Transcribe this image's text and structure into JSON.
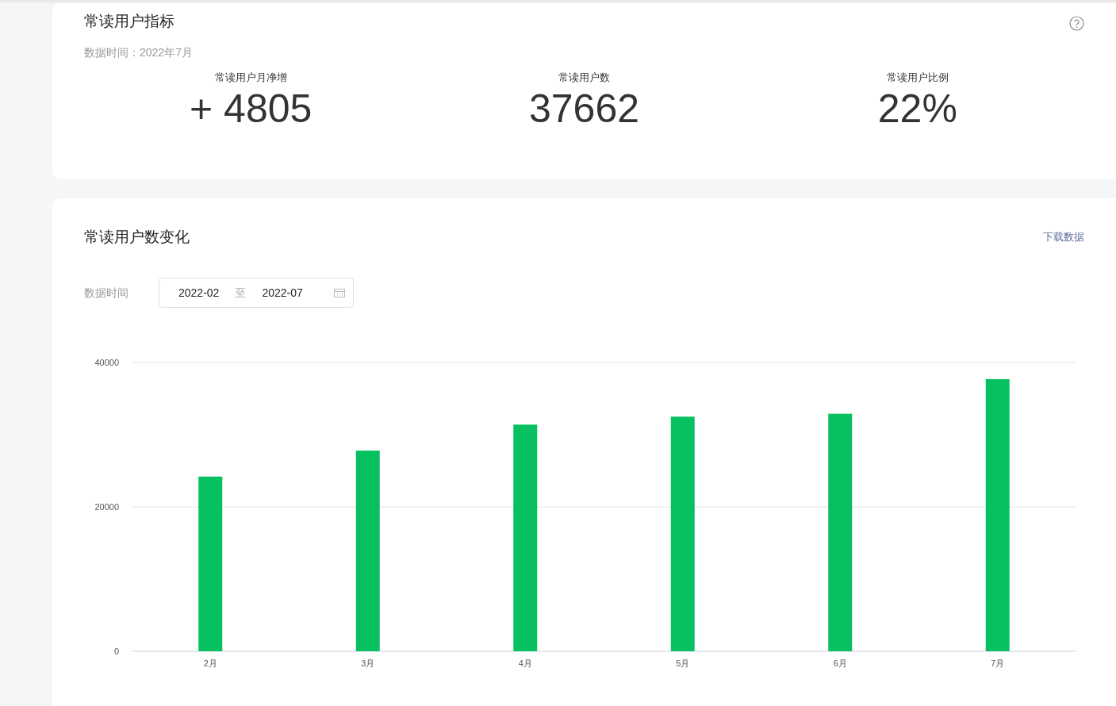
{
  "metrics_card": {
    "title": "常读用户指标",
    "data_time": "数据时间：2022年7月",
    "metrics": [
      {
        "label": "常读用户月净增",
        "value": "+ 4805"
      },
      {
        "label": "常读用户数",
        "value": "37662"
      },
      {
        "label": "常读用户比例",
        "value": "22%"
      }
    ]
  },
  "trend_card": {
    "title": "常读用户数变化",
    "download_link": "下载数据",
    "date_label": "数据时间",
    "date_range": {
      "start": "2022-02",
      "separator": "至",
      "end": "2022-07"
    },
    "chart_data": {
      "type": "bar",
      "categories": [
        "2月",
        "3月",
        "4月",
        "5月",
        "6月",
        "7月"
      ],
      "series": [
        {
          "color": "#07c160",
          "values": [
            24200,
            27800,
            31400,
            32500,
            32900,
            37700
          ]
        }
      ],
      "ylim": [
        0,
        40000
      ],
      "yticks": [
        0,
        20000,
        40000
      ]
    }
  }
}
